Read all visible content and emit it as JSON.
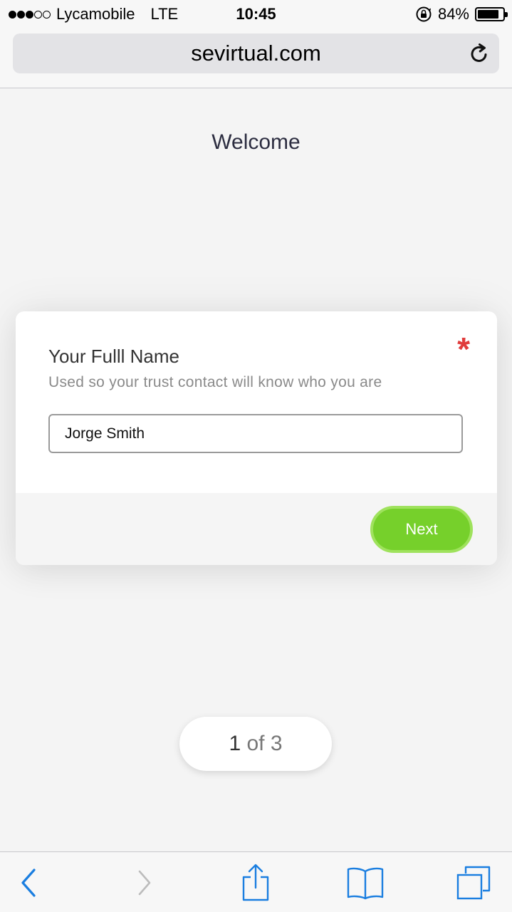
{
  "status_bar": {
    "carrier": "Lycamobile",
    "network": "LTE",
    "time": "10:45",
    "battery_percent": "84%",
    "battery_level": 0.84,
    "signal_bars_filled": 3,
    "signal_bars_total": 5
  },
  "browser": {
    "url": "sevirtual.com",
    "reload_icon": "reload-icon"
  },
  "page": {
    "title": "Welcome"
  },
  "form": {
    "field_label": "Your Fulll Name",
    "required_mark": "*",
    "help_text": "Used so your trust contact will know who you are",
    "name_value": "Jorge Smith",
    "next_label": "Next"
  },
  "pagination": {
    "current": "1",
    "rest": " of 3"
  },
  "toolbar": {
    "icons": [
      "back-icon",
      "forward-icon",
      "share-icon",
      "bookmarks-icon",
      "tabs-icon"
    ]
  },
  "colors": {
    "accent_green": "#76d02b",
    "required_red": "#e03c3c",
    "ios_blue": "#1a7ee0",
    "disabled_gray": "#bcbcbc"
  }
}
